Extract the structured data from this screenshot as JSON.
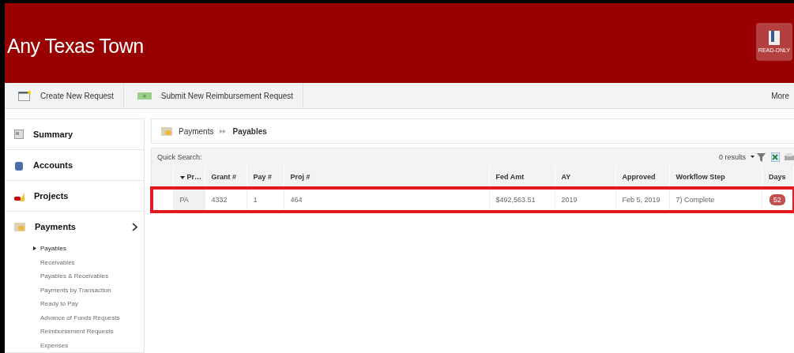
{
  "header": {
    "title": "Any Texas Town",
    "badge": "READ-ONLY"
  },
  "toolbar": {
    "actions": [
      "Create New Request",
      "Submit New Reimbursement Request"
    ],
    "more": "More"
  },
  "sidebar": {
    "items": [
      {
        "label": "Summary",
        "expanded": false
      },
      {
        "label": "Accounts",
        "expanded": false
      },
      {
        "label": "Projects",
        "expanded": false
      },
      {
        "label": "Payments",
        "expanded": true,
        "children": [
          {
            "label": "Payables",
            "selected": true
          },
          {
            "label": "Receivables",
            "selected": false
          },
          {
            "label": "Payables & Receivables",
            "selected": false
          },
          {
            "label": "Payments by Transaction",
            "selected": false
          },
          {
            "label": "Ready to Pay",
            "selected": false
          },
          {
            "label": "Advance of Funds Requests",
            "selected": false
          },
          {
            "label": "Reimbursement Requests",
            "selected": false
          },
          {
            "label": "Expenses",
            "selected": false
          }
        ]
      }
    ]
  },
  "breadcrumb": {
    "parent": "Payments",
    "current": "Payables"
  },
  "quick_search": {
    "label": "Quick Search:",
    "results": "0 results"
  },
  "table": {
    "columns": [
      "Pr…",
      "Grant #",
      "Pay #",
      "Proj #",
      "Fed Amt",
      "AY",
      "Approved",
      "Workflow Step",
      "Days"
    ],
    "rows": [
      {
        "highlighted": true,
        "cells": [
          "PA",
          "4332",
          "1",
          "464",
          "$492,563.51",
          "2019",
          "Feb 5, 2019",
          "7) Complete",
          "52"
        ]
      }
    ]
  }
}
